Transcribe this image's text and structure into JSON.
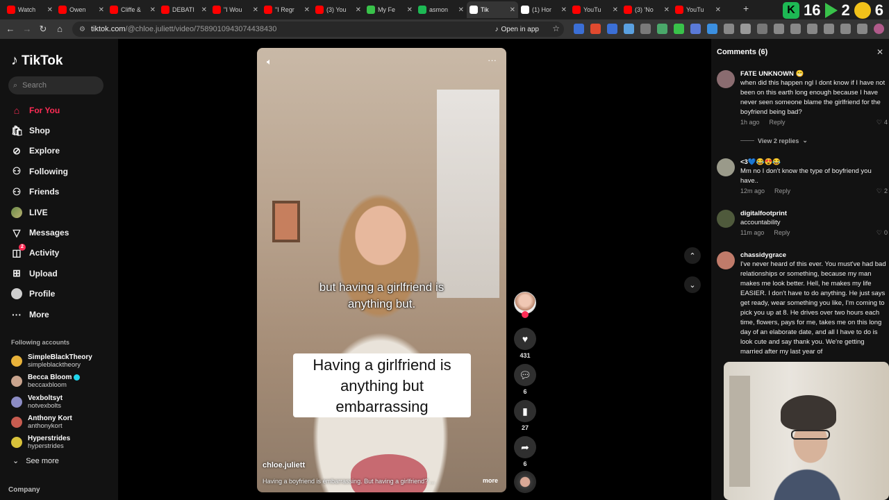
{
  "browser": {
    "tabs": [
      {
        "title": "Watch",
        "color": "#ff0000"
      },
      {
        "title": "Owen",
        "color": "#ff0000"
      },
      {
        "title": "Cliffe &",
        "color": "#ff0000"
      },
      {
        "title": "DEBATI",
        "color": "#ff0000"
      },
      {
        "title": "\"I Wou",
        "color": "#ff0000"
      },
      {
        "title": "\"I Regr",
        "color": "#ff0000"
      },
      {
        "title": "(3) You",
        "color": "#ff0000"
      },
      {
        "title": "My Fe",
        "color": "#39c24a"
      },
      {
        "title": "asmon",
        "color": "#1db954"
      },
      {
        "title": "Tik",
        "color": "#ffffff",
        "active": true
      },
      {
        "title": "(1) Hor",
        "color": "#ffffff"
      },
      {
        "title": "YouTu",
        "color": "#ff0000"
      },
      {
        "title": "(3) 'No",
        "color": "#ff0000"
      },
      {
        "title": "YouTu",
        "color": "#ff0000"
      }
    ],
    "overlay_numbers": [
      "16",
      "2",
      "6"
    ],
    "url_site": "tiktok.com",
    "url_path": "/@chloe.juliett/video/7589010943074438430",
    "open_in_app": "Open in app"
  },
  "sidebar": {
    "logo": "TikTok",
    "search_placeholder": "Search",
    "nav": [
      {
        "label": "For You",
        "icon": "home-icon",
        "active": true
      },
      {
        "label": "Shop",
        "icon": "shop-icon"
      },
      {
        "label": "Explore",
        "icon": "compass-icon"
      },
      {
        "label": "Following",
        "icon": "following-icon"
      },
      {
        "label": "Friends",
        "icon": "friends-icon"
      },
      {
        "label": "LIVE",
        "icon": "live-avatar-icon"
      },
      {
        "label": "Messages",
        "icon": "messages-icon"
      },
      {
        "label": "Activity",
        "icon": "activity-icon",
        "badge": "2"
      },
      {
        "label": "Upload",
        "icon": "upload-icon"
      },
      {
        "label": "Profile",
        "icon": "profile-avatar-icon"
      },
      {
        "label": "More",
        "icon": "more-icon"
      }
    ],
    "following_header": "Following accounts",
    "accounts": [
      {
        "name": "SimpleBlackTheory",
        "handle": "simpleblacktheory",
        "color": "#e8b23a"
      },
      {
        "name": "Becca Bloom",
        "handle": "beccaxbloom",
        "verified": true,
        "color": "#c9a48e"
      },
      {
        "name": "Vexboltsyt",
        "handle": "notvexbolts",
        "color": "#8c8cc4"
      },
      {
        "name": "Anthony Kort",
        "handle": "anthonykort",
        "color": "#c75c50"
      },
      {
        "name": "Hyperstrides",
        "handle": "hyperstrides",
        "color": "#d8c23a"
      }
    ],
    "see_more": "See more",
    "company": "Company"
  },
  "video": {
    "caption_top": "but having a girlfriend is anything but.",
    "caption_box": "Having a girlfriend is anything but embarrassing",
    "username": "chloe.juliett",
    "description": "Having a boyfriend is embarrassing. But having a girlfriend? ...",
    "more": "more",
    "likes": "431",
    "comments": "6",
    "saves": "27",
    "shares": "6"
  },
  "comments_panel": {
    "title": "Comments (6)",
    "reply_label": "Reply",
    "view_replies": "View 2 replies",
    "items": [
      {
        "user": "FATE UNKNOWN 😁",
        "text": "when did this happen ngl I dont know if I have not been on this earth long enough because I have never seen someone blame the girlfriend for the boyfriend being bad?",
        "time": "1h ago",
        "likes": "4",
        "color": "#8a6c70"
      },
      {
        "user": "<3💙😂😍😂",
        "text": "Mm no I don't know the type of boyfriend you have..",
        "time": "12m ago",
        "likes": "2",
        "color": "#9a9a8a"
      },
      {
        "user": "digitalfootprint",
        "text": "accountability",
        "time": "11m ago",
        "likes": "0",
        "color": "#4f5a3c"
      },
      {
        "user": "chassidygrace",
        "text": "I've never heard of this ever. You must've had bad relationships or something, because my man makes me look better. Hell, he makes my life EASIER. I don't have to do anything. He just says get ready, wear something you like, I'm coming to pick you up at 8. He drives over two hours each time, flowers, pays for me, takes me on this long day of an elaborate date, and all I have to do is look cute and say thank you. We're getting married after my last year of",
        "time": "",
        "likes": "",
        "color": "#c07b6a"
      }
    ]
  }
}
